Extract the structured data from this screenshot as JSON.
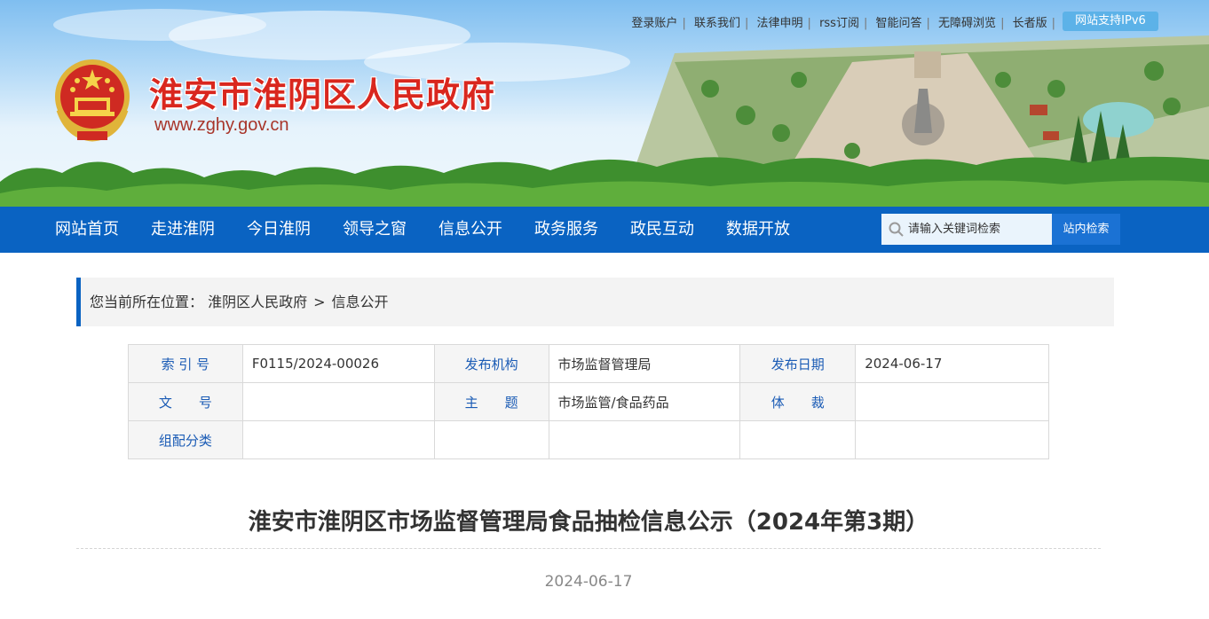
{
  "header": {
    "top_links": [
      "登录账户",
      "联系我们",
      "法律申明",
      "rss订阅",
      "智能问答",
      "无障碍浏览",
      "长者版"
    ],
    "ipv6_badge": "网站支持IPv6",
    "site_title": "淮安市淮阴区人民政府",
    "site_url": "www.zghy.gov.cn"
  },
  "nav": {
    "items": [
      "网站首页",
      "走进淮阴",
      "今日淮阴",
      "领导之窗",
      "信息公开",
      "政务服务",
      "政民互动",
      "数据开放"
    ],
    "search_placeholder": "请输入关键词检索",
    "search_button": "站内检索"
  },
  "breadcrumb": {
    "prefix": "您当前所在位置：",
    "crumbs": [
      "淮阴区人民政府",
      "信息公开"
    ],
    "separator": ">"
  },
  "meta": {
    "rows": [
      [
        {
          "label": "索 引 号",
          "value": "F0115/2024-00026"
        },
        {
          "label": "发布机构",
          "value": "市场监督管理局"
        },
        {
          "label": "发布日期",
          "value": "2024-06-17"
        }
      ],
      [
        {
          "label": "文　　号",
          "value": ""
        },
        {
          "label": "主　　题",
          "value": "市场监管/食品药品"
        },
        {
          "label": "体　　裁",
          "value": ""
        }
      ],
      [
        {
          "label": "组配分类",
          "value": ""
        },
        {
          "label": "",
          "value": ""
        },
        {
          "label": "",
          "value": ""
        }
      ]
    ]
  },
  "article": {
    "title": "淮安市淮阴区市场监督管理局食品抽检信息公示（2024年第3期）",
    "date": "2024-06-17"
  },
  "colors": {
    "nav_bg": "#0a63c2",
    "title_red": "#d9271e",
    "label_blue": "#1a5bb5"
  }
}
